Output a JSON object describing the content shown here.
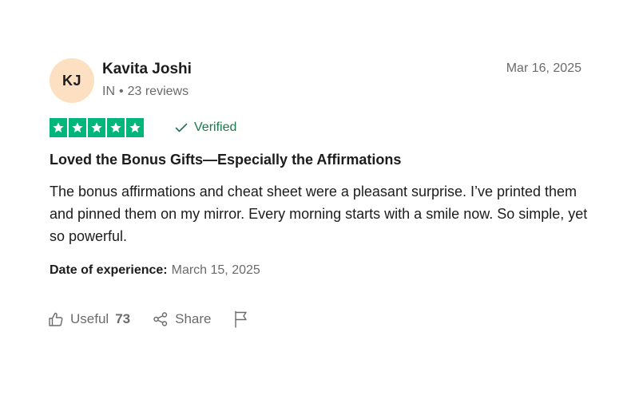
{
  "reviewer": {
    "initials": "KJ",
    "name": "Kavita Joshi",
    "country": "IN",
    "separator": "•",
    "reviews_count": "23 reviews",
    "avatar_color": "#fde0c2"
  },
  "review": {
    "date": "Mar 16, 2025",
    "rating": 5,
    "max_rating": 5,
    "star_color": "#00b67a",
    "verified_label": "Verified",
    "verified_color": "#1a7a4c",
    "title": "Loved the Bonus Gifts—Especially the Affirmations",
    "body": "The bonus affirmations and cheat sheet were a pleasant surprise. I’ve printed them and pinned them on my mirror. Every morning starts with a smile now. So simple, yet so powerful.",
    "experience_label": "Date of experience:",
    "experience_date": "March 15, 2025"
  },
  "actions": {
    "useful_label": "Useful",
    "useful_count": "73",
    "share_label": "Share",
    "icons": {
      "useful": "thumbs-up-icon",
      "share": "share-icon",
      "report": "flag-icon"
    }
  }
}
